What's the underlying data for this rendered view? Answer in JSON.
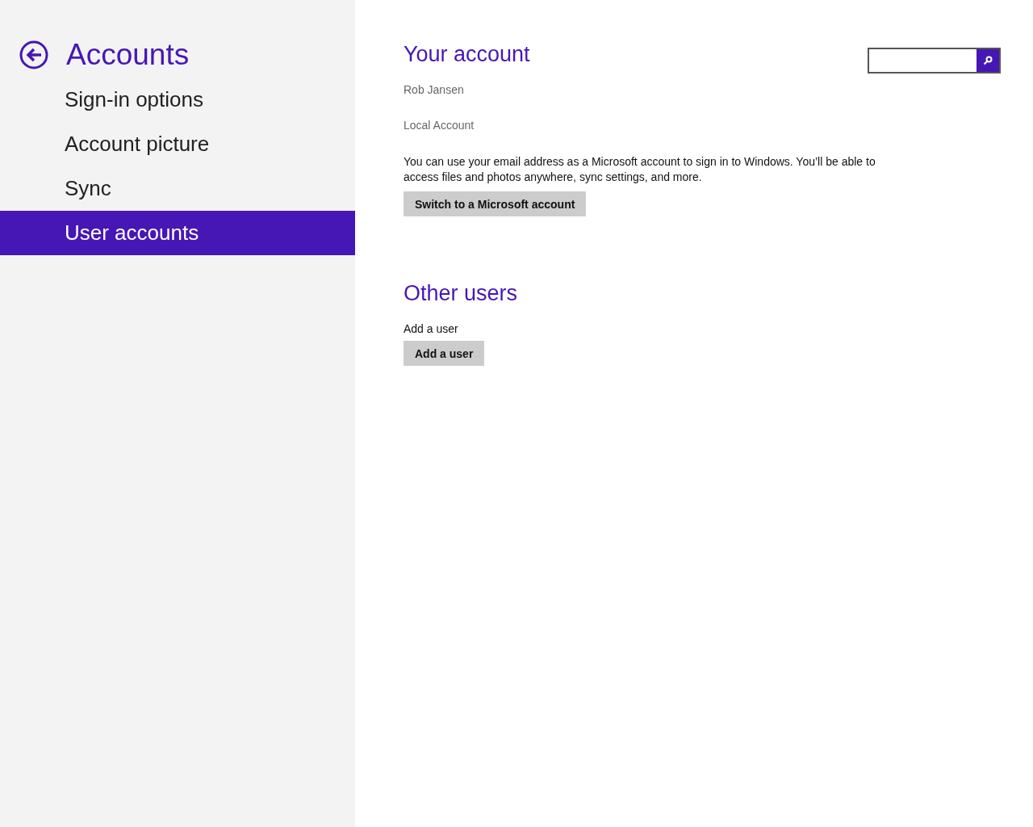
{
  "sidebar": {
    "title": "Accounts",
    "items": [
      {
        "label": "Sign-in options",
        "selected": false
      },
      {
        "label": "Account picture",
        "selected": false
      },
      {
        "label": "Sync",
        "selected": false
      },
      {
        "label": "User accounts",
        "selected": true
      }
    ]
  },
  "sections": [
    {
      "heading": "Your account",
      "items": [
        {
          "kind": "info",
          "text": "Rob Jansen"
        },
        {
          "kind": "info",
          "text": "Local Account"
        },
        {
          "kind": "paragraph",
          "text": "You can use your email address as a Microsoft account to sign in to Windows. You’ll be able to access files and photos anywhere, sync settings, and more."
        },
        {
          "kind": "button",
          "text": "Switch to a Microsoft account"
        }
      ]
    },
    {
      "heading": "Other users",
      "items": [
        {
          "kind": "label",
          "text": "Add a user"
        },
        {
          "kind": "button",
          "text": "Add a user"
        }
      ]
    }
  ]
}
